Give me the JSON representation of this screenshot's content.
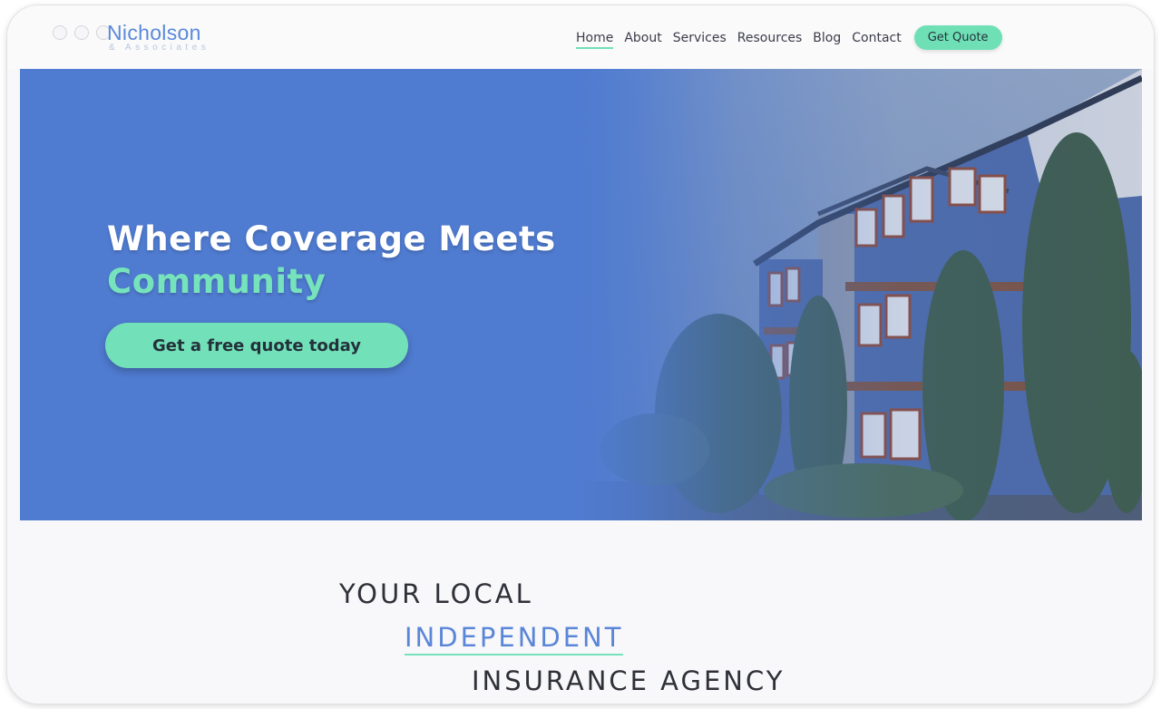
{
  "header": {
    "brand_name": "Nicholson",
    "brand_sub": "& Associates",
    "nav": [
      {
        "label": "Home",
        "active": true
      },
      {
        "label": "About"
      },
      {
        "label": "Services"
      },
      {
        "label": "Resources"
      },
      {
        "label": "Blog"
      },
      {
        "label": "Contact"
      }
    ],
    "cta_label": "Get Quote"
  },
  "hero": {
    "title_line1": "Where Coverage Meets",
    "title_line2": "Community",
    "cta_label": "Get a free quote today"
  },
  "tagline": {
    "line1": "YOUR LOCAL",
    "line2": "INDEPENDENT",
    "line3": "INSURANCE AGENCY"
  },
  "colors": {
    "brand_blue": "#4f7bd0",
    "accent_mint": "#72e0b8",
    "text_dark": "#2f3138"
  }
}
